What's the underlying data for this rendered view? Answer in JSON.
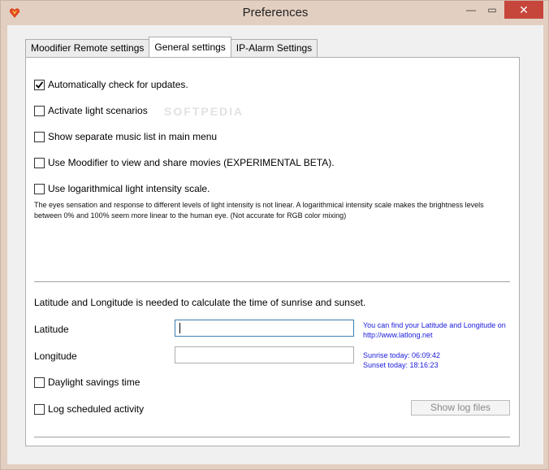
{
  "window": {
    "title": "Preferences",
    "minimize_glyph": "—",
    "maximize_glyph": "▭",
    "close_glyph": "✕"
  },
  "tabs": [
    {
      "label": "Moodifier Remote settings",
      "active": false
    },
    {
      "label": "General settings",
      "active": true
    },
    {
      "label": "IP-Alarm Settings",
      "active": false
    }
  ],
  "general": {
    "checkboxes": [
      {
        "label": "Automatically check for updates.",
        "checked": true
      },
      {
        "label": "Activate light scenarios",
        "checked": false
      },
      {
        "label": "Show separate music list in main menu",
        "checked": false
      },
      {
        "label": "Use Moodifier to view and share movies (EXPERIMENTAL BETA).",
        "checked": false
      },
      {
        "label": "Use logarithmical light intensity scale.",
        "checked": false
      }
    ],
    "log_note": "The eyes sensation and response to different levels of light intensity is not linear. A logarithmical intensity scale makes the brightness levels between 0% and 100% seem more linear to the human eye. (Not accurate for RGB color mixing)"
  },
  "location": {
    "heading": "Latitude and Longitude is needed to calculate the time of sunrise and sunset.",
    "latitude_label": "Latitude",
    "latitude_value": "",
    "longitude_label": "Longitude",
    "longitude_value": "",
    "find_hint_line1": "You can find your Latitude and Longitude on",
    "find_hint_line2": "http://www.latlong.net",
    "sunrise": "Sunrise today: 06:09:42",
    "sunset": "Sunset today: 18:16:23",
    "daylight_label": "Daylight savings time",
    "daylight_checked": false,
    "log_label": "Log scheduled activity",
    "log_checked": false,
    "show_log_label": "Show log files"
  },
  "watermark": "SOFTPEDIA",
  "colors": {
    "close_button": "#c7463c",
    "link_blue": "#1a1adb",
    "frame": "#e3cfc1"
  },
  "icons": {
    "app": "heart-logo-icon",
    "check": "checkmark-icon"
  }
}
